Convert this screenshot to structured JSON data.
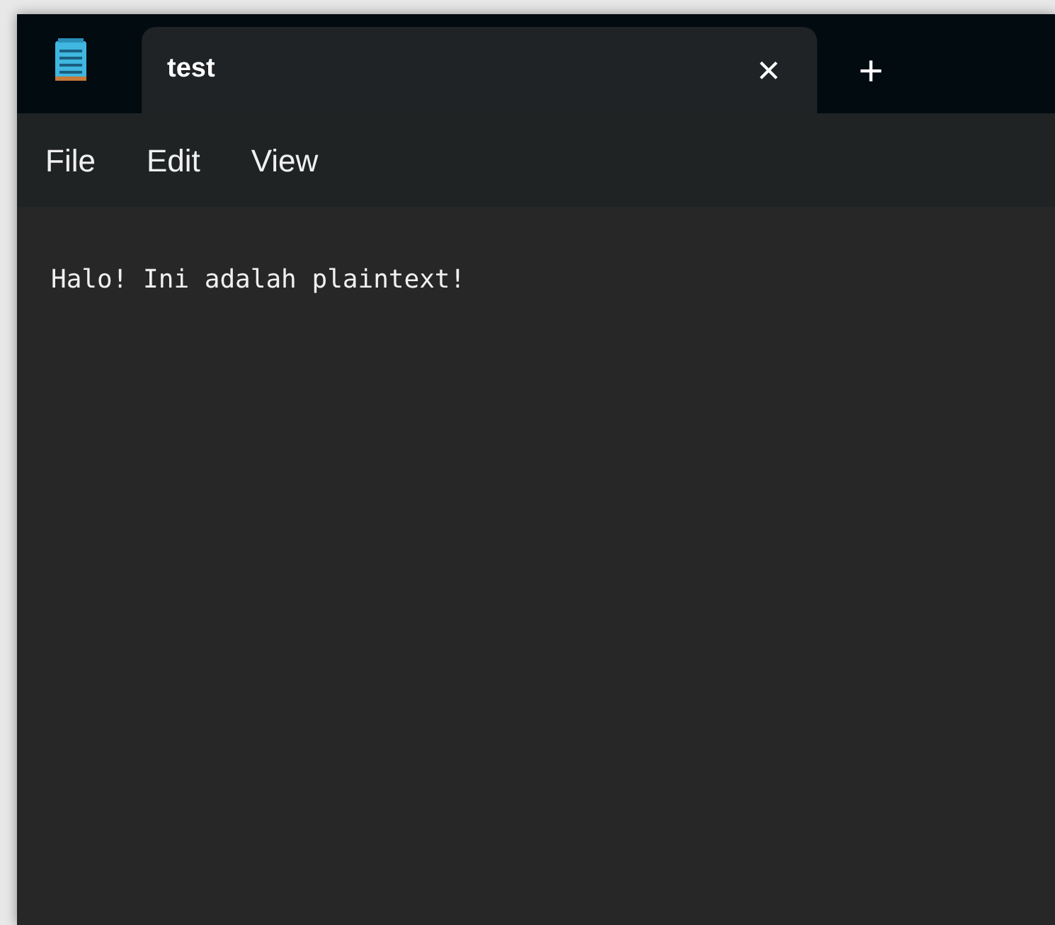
{
  "tabs": [
    {
      "label": "test",
      "close": "×",
      "selected": true
    }
  ],
  "new_tab": "+",
  "menu": [
    "File",
    "Edit",
    "View"
  ],
  "editor": {
    "text": "Halo! Ini adalah plaintext!"
  }
}
